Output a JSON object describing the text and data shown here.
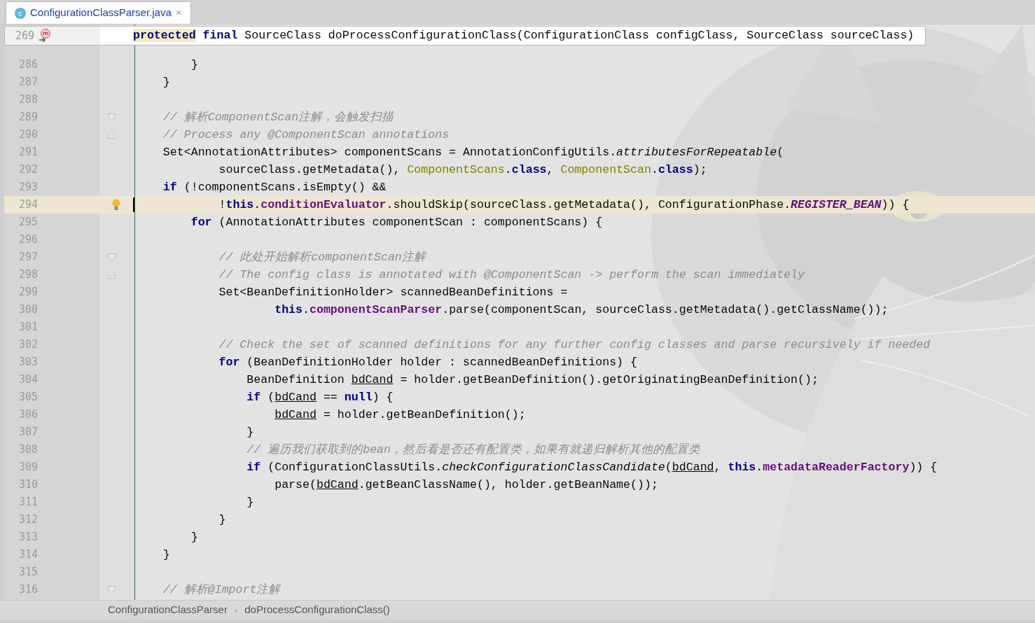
{
  "tab": {
    "icon_letter": "c",
    "title": "ConfigurationClassParser.java",
    "close": "×",
    "selected": true
  },
  "sticky_header": {
    "line_number": "269",
    "tokens": [
      {
        "text": "protected",
        "kind": "keyword-highlighted"
      },
      {
        "text": " final",
        "kind": "keyword"
      },
      {
        "text": " SourceClass doProcessConfigurationClass(ConfigurationClass configClass, SourceClass sourceClass)",
        "kind": "plain"
      }
    ]
  },
  "lines": [
    {
      "number": "286",
      "current": false,
      "bulb": false,
      "fold_start": false,
      "fold_end": false,
      "tokens": [
        {
          "text": "        }",
          "kind": "plain"
        }
      ]
    },
    {
      "number": "287",
      "current": false,
      "bulb": false,
      "fold_start": false,
      "fold_end": false,
      "tokens": [
        {
          "text": "    }",
          "kind": "plain"
        }
      ]
    },
    {
      "number": "288",
      "current": false,
      "bulb": false,
      "fold_start": false,
      "fold_end": false
    },
    {
      "number": "289",
      "current": false,
      "bulb": false,
      "fold_start": true,
      "fold_end": false,
      "tokens": [
        {
          "text": "    // 解析ComponentScan注解，会触发扫描",
          "kind": "comment"
        }
      ]
    },
    {
      "number": "290",
      "current": false,
      "bulb": false,
      "fold_start": false,
      "fold_end": true,
      "tokens": [
        {
          "text": "    // Process any @ComponentScan annotations",
          "kind": "comment"
        }
      ]
    },
    {
      "number": "291",
      "current": false,
      "bulb": false,
      "fold_start": false,
      "fold_end": false,
      "tokens": [
        {
          "text": "    Set<AnnotationAttributes> componentScans = AnnotationConfigUtils.",
          "kind": "plain"
        },
        {
          "text": "attributesForRepeatable",
          "kind": "static-method"
        },
        {
          "text": "(",
          "kind": "plain"
        }
      ]
    },
    {
      "number": "292",
      "current": false,
      "bulb": false,
      "fold_start": false,
      "fold_end": false,
      "tokens": [
        {
          "text": "            sourceClass.getMetadata(), ",
          "kind": "plain"
        },
        {
          "text": "ComponentScans",
          "kind": "annotation"
        },
        {
          "text": ".",
          "kind": "plain"
        },
        {
          "text": "class",
          "kind": "keyword"
        },
        {
          "text": ", ",
          "kind": "plain"
        },
        {
          "text": "ComponentScan",
          "kind": "annotation"
        },
        {
          "text": ".",
          "kind": "plain"
        },
        {
          "text": "class",
          "kind": "keyword"
        },
        {
          "text": ");",
          "kind": "plain"
        }
      ]
    },
    {
      "number": "293",
      "current": false,
      "bulb": false,
      "fold_start": false,
      "fold_end": false,
      "tokens": [
        {
          "text": "    if",
          "kind": "keyword"
        },
        {
          "text": " (!componentScans.isEmpty() &&",
          "kind": "plain"
        }
      ]
    },
    {
      "number": "294",
      "current": true,
      "bulb": true,
      "fold_start": false,
      "fold_end": false,
      "tokens": [
        {
          "text": "            !",
          "kind": "plain"
        },
        {
          "text": "this",
          "kind": "keyword"
        },
        {
          "text": ".",
          "kind": "plain"
        },
        {
          "text": "conditionEvaluator",
          "kind": "field"
        },
        {
          "text": ".shouldSkip(sourceClass.getMetadata(), ConfigurationPhase.",
          "kind": "plain"
        },
        {
          "text": "REGISTER_BEAN",
          "kind": "constant"
        },
        {
          "text": ")) {",
          "kind": "plain"
        }
      ]
    },
    {
      "number": "295",
      "current": false,
      "bulb": false,
      "fold_start": false,
      "fold_end": false,
      "tokens": [
        {
          "text": "        for",
          "kind": "keyword"
        },
        {
          "text": " (AnnotationAttributes componentScan : componentScans) {",
          "kind": "plain"
        }
      ]
    },
    {
      "number": "296",
      "current": false,
      "bulb": false,
      "fold_start": false,
      "fold_end": false
    },
    {
      "number": "297",
      "current": false,
      "bulb": false,
      "fold_start": true,
      "fold_end": false,
      "tokens": [
        {
          "text": "            // 此处开始解析componentScan注解",
          "kind": "comment"
        }
      ]
    },
    {
      "number": "298",
      "current": false,
      "bulb": false,
      "fold_start": false,
      "fold_end": true,
      "tokens": [
        {
          "text": "            // The config class is annotated with @ComponentScan -> perform the scan immediately",
          "kind": "comment"
        }
      ]
    },
    {
      "number": "299",
      "current": false,
      "bulb": false,
      "fold_start": false,
      "fold_end": false,
      "tokens": [
        {
          "text": "            Set<BeanDefinitionHolder> scannedBeanDefinitions =",
          "kind": "plain"
        }
      ]
    },
    {
      "number": "300",
      "current": false,
      "bulb": false,
      "fold_start": false,
      "fold_end": false,
      "tokens": [
        {
          "text": "                    this",
          "kind": "keyword"
        },
        {
          "text": ".",
          "kind": "plain"
        },
        {
          "text": "componentScanParser",
          "kind": "field"
        },
        {
          "text": ".parse(componentScan, sourceClass.getMetadata().getClassName());",
          "kind": "plain"
        }
      ]
    },
    {
      "number": "301",
      "current": false,
      "bulb": false,
      "fold_start": false,
      "fold_end": false
    },
    {
      "number": "302",
      "current": false,
      "bulb": false,
      "fold_start": false,
      "fold_end": false,
      "tokens": [
        {
          "text": "            // Check the set of scanned definitions for any further config classes and parse recursively if needed",
          "kind": "comment"
        }
      ]
    },
    {
      "number": "303",
      "current": false,
      "bulb": false,
      "fold_start": false,
      "fold_end": false,
      "tokens": [
        {
          "text": "            for",
          "kind": "keyword"
        },
        {
          "text": " (BeanDefinitionHolder holder : scannedBeanDefinitions) {",
          "kind": "plain"
        }
      ]
    },
    {
      "number": "304",
      "current": false,
      "bulb": false,
      "fold_start": false,
      "fold_end": false,
      "tokens": [
        {
          "text": "                BeanDefinition ",
          "kind": "plain"
        },
        {
          "text": "bdCand",
          "kind": "reassigned"
        },
        {
          "text": " = holder.getBeanDefinition().getOriginatingBeanDefinition();",
          "kind": "plain"
        }
      ]
    },
    {
      "number": "305",
      "current": false,
      "bulb": false,
      "fold_start": false,
      "fold_end": false,
      "tokens": [
        {
          "text": "                if",
          "kind": "keyword"
        },
        {
          "text": " (",
          "kind": "plain"
        },
        {
          "text": "bdCand",
          "kind": "reassigned"
        },
        {
          "text": " == ",
          "kind": "plain"
        },
        {
          "text": "null",
          "kind": "keyword"
        },
        {
          "text": ") {",
          "kind": "plain"
        }
      ]
    },
    {
      "number": "306",
      "current": false,
      "bulb": false,
      "fold_start": false,
      "fold_end": false,
      "tokens": [
        {
          "text": "                    bdCand",
          "kind": "reassigned"
        },
        {
          "text": " = holder.getBeanDefinition();",
          "kind": "plain"
        }
      ]
    },
    {
      "number": "307",
      "current": false,
      "bulb": false,
      "fold_start": false,
      "fold_end": false,
      "tokens": [
        {
          "text": "                }",
          "kind": "plain"
        }
      ]
    },
    {
      "number": "308",
      "current": false,
      "bulb": false,
      "fold_start": false,
      "fold_end": false,
      "tokens": [
        {
          "text": "                // 遍历我们获取到的bean，然后看是否还有配置类，如果有就递归解析其他的配置类",
          "kind": "comment"
        }
      ]
    },
    {
      "number": "309",
      "current": false,
      "bulb": false,
      "fold_start": false,
      "fold_end": false,
      "tokens": [
        {
          "text": "                if",
          "kind": "keyword"
        },
        {
          "text": " (ConfigurationClassUtils.",
          "kind": "plain"
        },
        {
          "text": "checkConfigurationClassCandidate",
          "kind": "static-method"
        },
        {
          "text": "(",
          "kind": "plain"
        },
        {
          "text": "bdCand",
          "kind": "reassigned"
        },
        {
          "text": ", ",
          "kind": "plain"
        },
        {
          "text": "this",
          "kind": "keyword"
        },
        {
          "text": ".",
          "kind": "plain"
        },
        {
          "text": "metadataReaderFactory",
          "kind": "field"
        },
        {
          "text": ")) {",
          "kind": "plain"
        }
      ]
    },
    {
      "number": "310",
      "current": false,
      "bulb": false,
      "fold_start": false,
      "fold_end": false,
      "tokens": [
        {
          "text": "                    parse(",
          "kind": "plain"
        },
        {
          "text": "bdCand",
          "kind": "reassigned"
        },
        {
          "text": ".getBeanClassName(), holder.getBeanName());",
          "kind": "plain"
        }
      ]
    },
    {
      "number": "311",
      "current": false,
      "bulb": false,
      "fold_start": false,
      "fold_end": false,
      "tokens": [
        {
          "text": "                }",
          "kind": "plain"
        }
      ]
    },
    {
      "number": "312",
      "current": false,
      "bulb": false,
      "fold_start": false,
      "fold_end": false,
      "tokens": [
        {
          "text": "            }",
          "kind": "plain"
        }
      ]
    },
    {
      "number": "313",
      "current": false,
      "bulb": false,
      "fold_start": false,
      "fold_end": false,
      "tokens": [
        {
          "text": "        }",
          "kind": "plain"
        }
      ]
    },
    {
      "number": "314",
      "current": false,
      "bulb": false,
      "fold_start": false,
      "fold_end": false,
      "tokens": [
        {
          "text": "    }",
          "kind": "plain"
        }
      ]
    },
    {
      "number": "315",
      "current": false,
      "bulb": false,
      "fold_start": false,
      "fold_end": false
    },
    {
      "number": "316",
      "current": false,
      "bulb": false,
      "fold_start": true,
      "fold_end": false,
      "tokens": [
        {
          "text": "    // 解析@Import注解",
          "kind": "comment"
        }
      ]
    }
  ],
  "breadcrumbs": [
    {
      "text": "ConfigurationClassParser",
      "separator": "›"
    },
    {
      "text": "doProcessConfigurationClass()"
    }
  ]
}
